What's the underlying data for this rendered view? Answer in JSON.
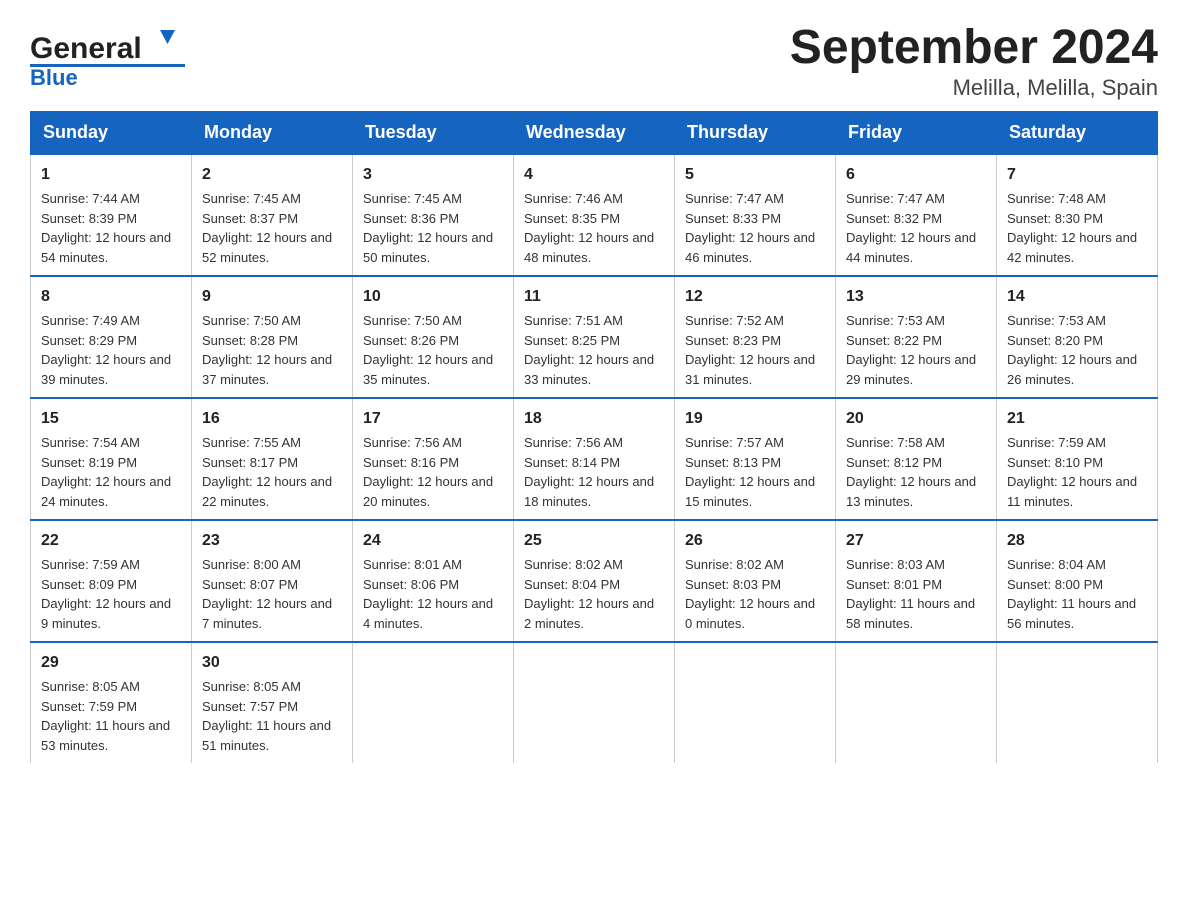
{
  "header": {
    "logo_general": "General",
    "logo_blue": "Blue",
    "main_title": "September 2024",
    "subtitle": "Melilla, Melilla, Spain"
  },
  "weekdays": [
    "Sunday",
    "Monday",
    "Tuesday",
    "Wednesday",
    "Thursday",
    "Friday",
    "Saturday"
  ],
  "weeks": [
    [
      {
        "day": "1",
        "sunrise": "7:44 AM",
        "sunset": "8:39 PM",
        "daylight": "12 hours and 54 minutes."
      },
      {
        "day": "2",
        "sunrise": "7:45 AM",
        "sunset": "8:37 PM",
        "daylight": "12 hours and 52 minutes."
      },
      {
        "day": "3",
        "sunrise": "7:45 AM",
        "sunset": "8:36 PM",
        "daylight": "12 hours and 50 minutes."
      },
      {
        "day": "4",
        "sunrise": "7:46 AM",
        "sunset": "8:35 PM",
        "daylight": "12 hours and 48 minutes."
      },
      {
        "day": "5",
        "sunrise": "7:47 AM",
        "sunset": "8:33 PM",
        "daylight": "12 hours and 46 minutes."
      },
      {
        "day": "6",
        "sunrise": "7:47 AM",
        "sunset": "8:32 PM",
        "daylight": "12 hours and 44 minutes."
      },
      {
        "day": "7",
        "sunrise": "7:48 AM",
        "sunset": "8:30 PM",
        "daylight": "12 hours and 42 minutes."
      }
    ],
    [
      {
        "day": "8",
        "sunrise": "7:49 AM",
        "sunset": "8:29 PM",
        "daylight": "12 hours and 39 minutes."
      },
      {
        "day": "9",
        "sunrise": "7:50 AM",
        "sunset": "8:28 PM",
        "daylight": "12 hours and 37 minutes."
      },
      {
        "day": "10",
        "sunrise": "7:50 AM",
        "sunset": "8:26 PM",
        "daylight": "12 hours and 35 minutes."
      },
      {
        "day": "11",
        "sunrise": "7:51 AM",
        "sunset": "8:25 PM",
        "daylight": "12 hours and 33 minutes."
      },
      {
        "day": "12",
        "sunrise": "7:52 AM",
        "sunset": "8:23 PM",
        "daylight": "12 hours and 31 minutes."
      },
      {
        "day": "13",
        "sunrise": "7:53 AM",
        "sunset": "8:22 PM",
        "daylight": "12 hours and 29 minutes."
      },
      {
        "day": "14",
        "sunrise": "7:53 AM",
        "sunset": "8:20 PM",
        "daylight": "12 hours and 26 minutes."
      }
    ],
    [
      {
        "day": "15",
        "sunrise": "7:54 AM",
        "sunset": "8:19 PM",
        "daylight": "12 hours and 24 minutes."
      },
      {
        "day": "16",
        "sunrise": "7:55 AM",
        "sunset": "8:17 PM",
        "daylight": "12 hours and 22 minutes."
      },
      {
        "day": "17",
        "sunrise": "7:56 AM",
        "sunset": "8:16 PM",
        "daylight": "12 hours and 20 minutes."
      },
      {
        "day": "18",
        "sunrise": "7:56 AM",
        "sunset": "8:14 PM",
        "daylight": "12 hours and 18 minutes."
      },
      {
        "day": "19",
        "sunrise": "7:57 AM",
        "sunset": "8:13 PM",
        "daylight": "12 hours and 15 minutes."
      },
      {
        "day": "20",
        "sunrise": "7:58 AM",
        "sunset": "8:12 PM",
        "daylight": "12 hours and 13 minutes."
      },
      {
        "day": "21",
        "sunrise": "7:59 AM",
        "sunset": "8:10 PM",
        "daylight": "12 hours and 11 minutes."
      }
    ],
    [
      {
        "day": "22",
        "sunrise": "7:59 AM",
        "sunset": "8:09 PM",
        "daylight": "12 hours and 9 minutes."
      },
      {
        "day": "23",
        "sunrise": "8:00 AM",
        "sunset": "8:07 PM",
        "daylight": "12 hours and 7 minutes."
      },
      {
        "day": "24",
        "sunrise": "8:01 AM",
        "sunset": "8:06 PM",
        "daylight": "12 hours and 4 minutes."
      },
      {
        "day": "25",
        "sunrise": "8:02 AM",
        "sunset": "8:04 PM",
        "daylight": "12 hours and 2 minutes."
      },
      {
        "day": "26",
        "sunrise": "8:02 AM",
        "sunset": "8:03 PM",
        "daylight": "12 hours and 0 minutes."
      },
      {
        "day": "27",
        "sunrise": "8:03 AM",
        "sunset": "8:01 PM",
        "daylight": "11 hours and 58 minutes."
      },
      {
        "day": "28",
        "sunrise": "8:04 AM",
        "sunset": "8:00 PM",
        "daylight": "11 hours and 56 minutes."
      }
    ],
    [
      {
        "day": "29",
        "sunrise": "8:05 AM",
        "sunset": "7:59 PM",
        "daylight": "11 hours and 53 minutes."
      },
      {
        "day": "30",
        "sunrise": "8:05 AM",
        "sunset": "7:57 PM",
        "daylight": "11 hours and 51 minutes."
      },
      null,
      null,
      null,
      null,
      null
    ]
  ],
  "labels": {
    "sunrise_prefix": "Sunrise: ",
    "sunset_prefix": "Sunset: ",
    "daylight_prefix": "Daylight: "
  }
}
